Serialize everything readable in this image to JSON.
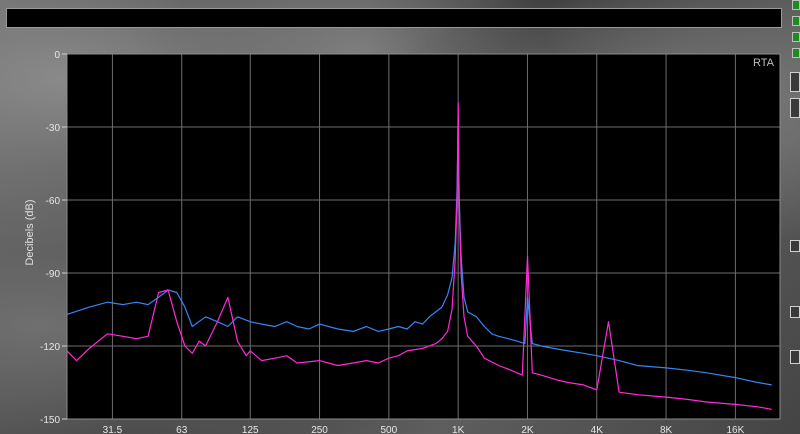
{
  "chart_data": {
    "type": "line",
    "label": "RTA",
    "ylabel": "Decibels (dB)",
    "xlabel": "",
    "x_scale": "log",
    "xlim": [
      20,
      25000
    ],
    "ylim": [
      -150,
      0
    ],
    "yticks": [
      0,
      -30,
      -60,
      -90,
      -120,
      -150
    ],
    "xticks": [
      {
        "value": 31.5,
        "label": "31.5"
      },
      {
        "value": 63,
        "label": "63"
      },
      {
        "value": 125,
        "label": "125"
      },
      {
        "value": 250,
        "label": "250"
      },
      {
        "value": 500,
        "label": "500"
      },
      {
        "value": 1000,
        "label": "1K"
      },
      {
        "value": 2000,
        "label": "2K"
      },
      {
        "value": 4000,
        "label": "4K"
      },
      {
        "value": 8000,
        "label": "8K"
      },
      {
        "value": 16000,
        "label": "16K"
      }
    ],
    "grid": true,
    "colors": {
      "series_1": "#3a8cff",
      "series_2": "#ff2bd6",
      "grid": "#6e6e6e",
      "background": "#000000"
    },
    "series": [
      {
        "color": "#3a8cff",
        "x": [
          20,
          25,
          30,
          35,
          40,
          45,
          50,
          55,
          60,
          65,
          70,
          80,
          90,
          100,
          110,
          125,
          140,
          160,
          180,
          200,
          225,
          250,
          300,
          350,
          400,
          450,
          500,
          550,
          600,
          650,
          700,
          750,
          800,
          850,
          900,
          940,
          970,
          990,
          1000,
          1010,
          1030,
          1060,
          1100,
          1200,
          1300,
          1400,
          1500,
          1650,
          1800,
          1950,
          2000,
          2100,
          2300,
          2600,
          3000,
          3500,
          4000,
          5000,
          6000,
          8000,
          10000,
          12000,
          16000,
          20000,
          23000
        ],
        "y": [
          -107,
          -104,
          -102,
          -103,
          -102,
          -103,
          -100,
          -97,
          -98,
          -104,
          -112,
          -108,
          -110,
          -112,
          -108,
          -110,
          -111,
          -112,
          -110,
          -112,
          -113,
          -111,
          -113,
          -114,
          -112,
          -114,
          -113,
          -112,
          -113,
          -110,
          -111,
          -108,
          -106,
          -104,
          -99,
          -92,
          -78,
          -55,
          -25,
          -58,
          -83,
          -100,
          -106,
          -108,
          -112,
          -115,
          -116,
          -117,
          -118,
          -119,
          -100,
          -119,
          -120,
          -121,
          -122,
          -123,
          -124,
          -126,
          -128,
          -129,
          -130,
          -131,
          -133,
          -135,
          -136
        ]
      },
      {
        "color": "#ff2bd6",
        "x": [
          20,
          22,
          25,
          30,
          35,
          40,
          45,
          50,
          55,
          60,
          65,
          70,
          75,
          80,
          90,
          100,
          110,
          120,
          125,
          140,
          160,
          180,
          200,
          250,
          300,
          350,
          400,
          450,
          500,
          550,
          600,
          700,
          800,
          850,
          900,
          940,
          970,
          990,
          1000,
          1010,
          1030,
          1060,
          1100,
          1200,
          1300,
          1500,
          1700,
          1900,
          2000,
          2100,
          2300,
          2700,
          3000,
          3500,
          4000,
          4500,
          5000,
          6000,
          8000,
          10000,
          12000,
          16000,
          20000,
          23000
        ],
        "y": [
          -122,
          -126,
          -121,
          -115,
          -116,
          -117,
          -116,
          -98,
          -97,
          -110,
          -120,
          -123,
          -118,
          -120,
          -110,
          -100,
          -118,
          -124,
          -122,
          -126,
          -125,
          -124,
          -127,
          -126,
          -128,
          -127,
          -126,
          -127,
          -125,
          -124,
          -122,
          -121,
          -119,
          -117,
          -114,
          -105,
          -85,
          -60,
          -20,
          -60,
          -90,
          -108,
          -116,
          -120,
          -125,
          -128,
          -130,
          -132,
          -83,
          -131,
          -132,
          -134,
          -135,
          -136,
          -138,
          -110,
          -139,
          -140,
          -141,
          -142,
          -143,
          -144,
          -145,
          -146
        ]
      }
    ]
  }
}
